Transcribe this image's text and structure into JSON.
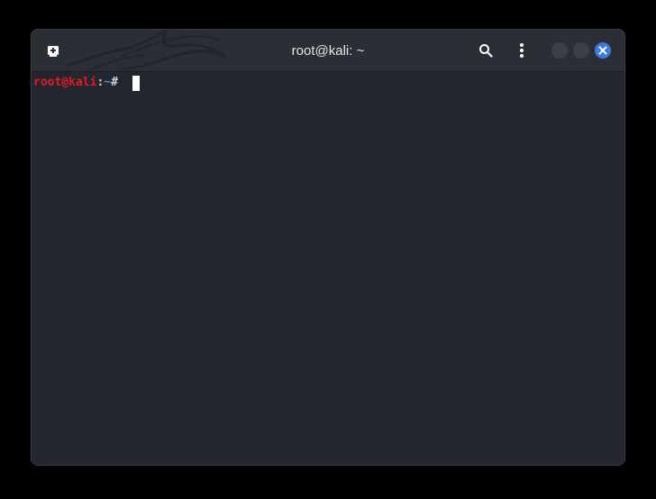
{
  "window": {
    "title": "root@kali: ~"
  },
  "headerbar": {
    "new_tab_icon": "new-tab-icon",
    "search_icon": "search-icon",
    "menu_icon": "kebab-menu-icon",
    "minimize_icon": "minimize-icon",
    "maximize_icon": "maximize-icon",
    "close_icon": "close-icon"
  },
  "terminal": {
    "prompt": {
      "user_host": "root@kali",
      "colon": ":",
      "path": "~",
      "symbol": "# "
    }
  },
  "colors": {
    "background": "#23262e",
    "headerbar": "#2b2e35",
    "prompt_user": "#e01b24",
    "prompt_path": "#3f8fe6",
    "close_button": "#3a7bde",
    "cursor": "#ffffff"
  }
}
